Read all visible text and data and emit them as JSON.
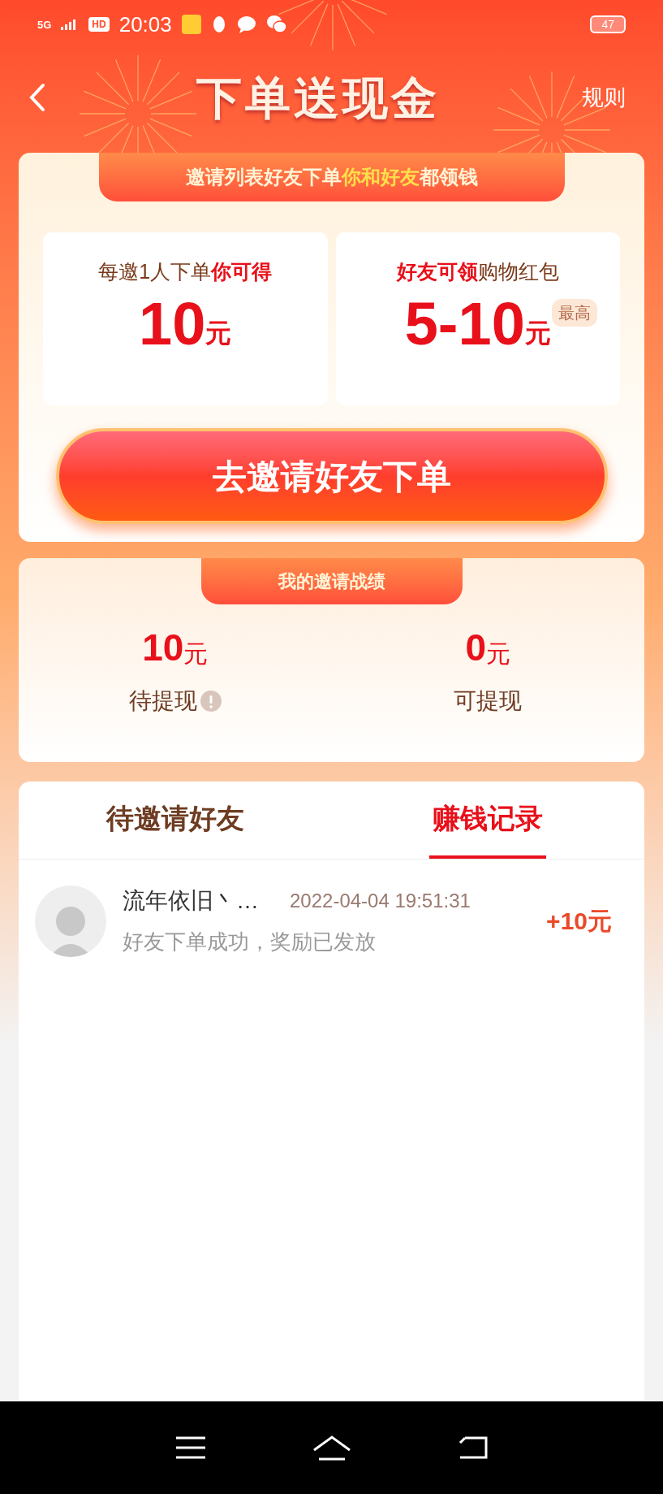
{
  "status_bar": {
    "network": "5G",
    "hd": "HD",
    "time": "20:03",
    "battery": "47"
  },
  "header": {
    "title": "下单送现金",
    "rules": "规则"
  },
  "invite_card": {
    "banner": "邀请列表好友下单**你和好友**都领钱",
    "rewards": [
      {
        "caption": "每邀1人下单**你可得**",
        "amount": "10",
        "unit": "元"
      },
      {
        "caption": "**好友可领**购物红包",
        "amount": "5-10",
        "unit": "元",
        "badge": "最高"
      }
    ],
    "button": "去邀请好友下单"
  },
  "stats_card": {
    "banner": "我的邀请战绩",
    "stats": [
      {
        "amount": "10",
        "unit": "元",
        "label": "待提现",
        "info": true
      },
      {
        "amount": "0",
        "unit": "元",
        "label": "可提现",
        "info": false
      }
    ]
  },
  "tabs": [
    {
      "label": "待邀请好友",
      "selected": false
    },
    {
      "label": "赚钱记录",
      "selected": true
    }
  ],
  "records": [
    {
      "name": "流年依旧丶…",
      "time": "2022-04-04 19:51:31",
      "desc": "好友下单成功，奖励已发放",
      "reward": "+10元"
    }
  ]
}
